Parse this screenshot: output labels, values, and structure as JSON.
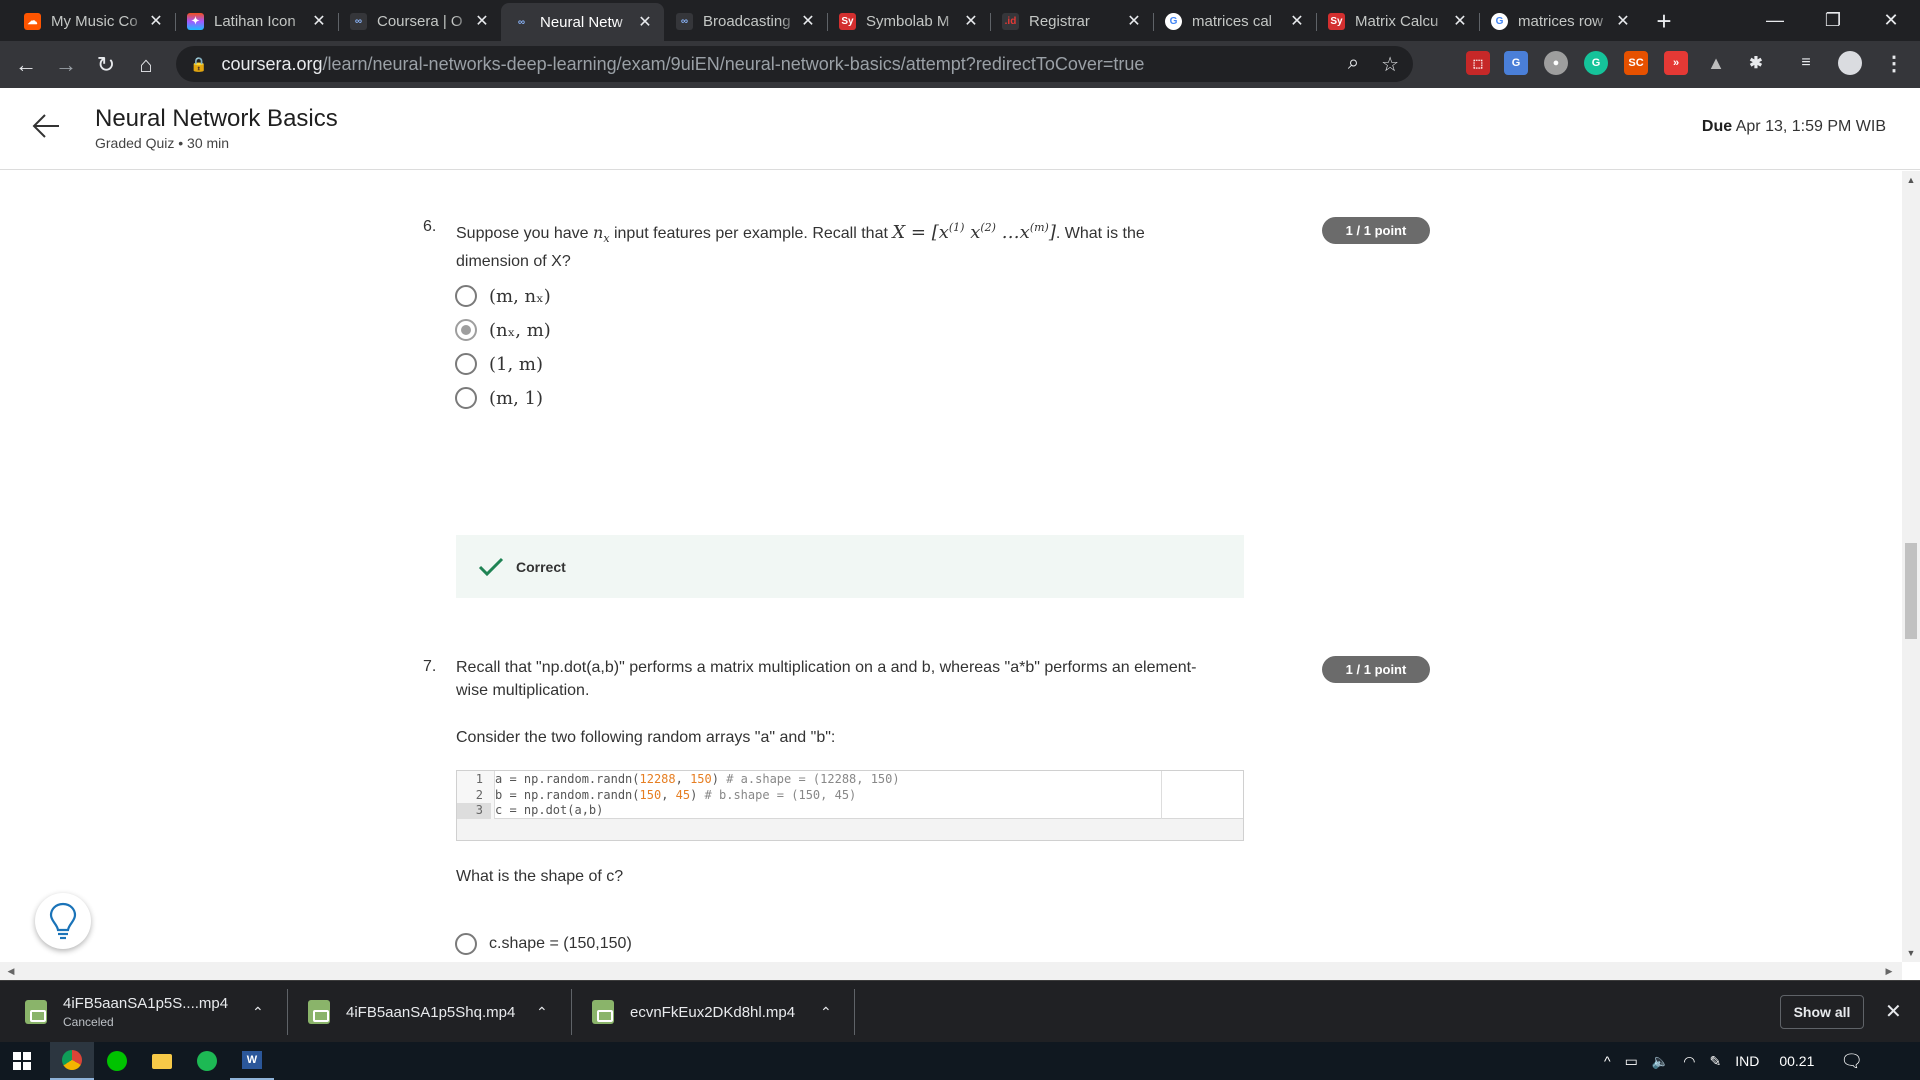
{
  "browser": {
    "tabs": [
      {
        "title": "My Music Co",
        "icon": "soundcloud-icon",
        "color": "#ff5500",
        "glyph": "☁",
        "active": false
      },
      {
        "title": "Latihan Icon",
        "icon": "figma-icon",
        "color": "#a259ff",
        "glyph": "✦",
        "active": false
      },
      {
        "title": "Coursera | O",
        "icon": "coursera-icon",
        "color": "#35363a",
        "glyph": "co",
        "active": false
      },
      {
        "title": "Neural Netw",
        "icon": "coursera-icon",
        "color": "#35363a",
        "glyph": "co",
        "active": true
      },
      {
        "title": "Broadcasting",
        "icon": "coursera-icon",
        "color": "#35363a",
        "glyph": "co",
        "active": false
      },
      {
        "title": "Symbolab M",
        "icon": "symbolab-icon",
        "color": "#d32f2f",
        "glyph": "Sy",
        "active": false
      },
      {
        "title": "Registrar",
        "icon": "id-registrar-icon",
        "color": "#35363a",
        "glyph": ".id",
        "active": false
      },
      {
        "title": "matrices cal",
        "icon": "google-icon",
        "color": "#ffffff",
        "glyph": "G",
        "active": false
      },
      {
        "title": "Matrix Calcu",
        "icon": "symbolab-icon",
        "color": "#d32f2f",
        "glyph": "Sy",
        "active": false
      },
      {
        "title": "matrices row",
        "icon": "google-icon",
        "color": "#ffffff",
        "glyph": "G",
        "active": false
      }
    ],
    "url_host": "coursera.org",
    "url_path": "/learn/neural-networks-deep-learning/exam/9uiEN/neural-network-basics/attempt?redirectToCover=true"
  },
  "header": {
    "title": "Neural Network Basics",
    "subtitle": "Graded Quiz • 30 min",
    "due_label": "Due",
    "due_value": "Apr 13, 1:59 PM WIB"
  },
  "q6": {
    "number": "6.",
    "text_a": "Suppose you have ",
    "text_b": " input features per example. Recall that ",
    "text_c": ". What is the",
    "text_d": "dimension of X?",
    "points": "1 / 1 point",
    "options": [
      {
        "label": "(m, nₓ)",
        "selected": false
      },
      {
        "label": "(nₓ, m)",
        "selected": true
      },
      {
        "label": "(1, m)",
        "selected": false
      },
      {
        "label": "(m, 1)",
        "selected": false
      }
    ],
    "feedback": "Correct"
  },
  "q7": {
    "number": "7.",
    "text_line1": "Recall that \"np.dot(a,b)\" performs a matrix multiplication on a and b, whereas \"a*b\" performs an element-",
    "text_line2": "wise multiplication.",
    "consider": "Consider the two following random arrays \"a\" and \"b\":",
    "points": "1 / 1 point",
    "code": [
      {
        "ln": "1",
        "pre": "a = np.random.randn(",
        "n1": "12288",
        "mid": ", ",
        "n2": "150",
        "post": ") ",
        "cm": "# a.shape = (12288, 150)"
      },
      {
        "ln": "2",
        "pre": "b = np.random.randn(",
        "n1": "150",
        "mid": ", ",
        "n2": "45",
        "post": ") ",
        "cm": "# b.shape = (150, 45)"
      },
      {
        "ln": "3",
        "pre": "c = np.dot(a,b)",
        "n1": "",
        "mid": "",
        "n2": "",
        "post": "",
        "cm": ""
      }
    ],
    "question": "What is the shape of c?",
    "first_option": "c.shape = (150,150)"
  },
  "downloads": {
    "items": [
      {
        "name": "4iFB5aanSA1p5S....mp4",
        "status": "Canceled"
      },
      {
        "name": "4iFB5aanSA1p5Shq.mp4",
        "status": ""
      },
      {
        "name": "ecvnFkEux2DKd8hl.mp4",
        "status": ""
      }
    ],
    "show_all": "Show all"
  },
  "taskbar": {
    "lang": "IND",
    "time": "00.21"
  },
  "colors": {
    "badge": "#6b6b6b",
    "correct_check": "#1f8354",
    "feedback_bg": "#f1f7f4"
  }
}
